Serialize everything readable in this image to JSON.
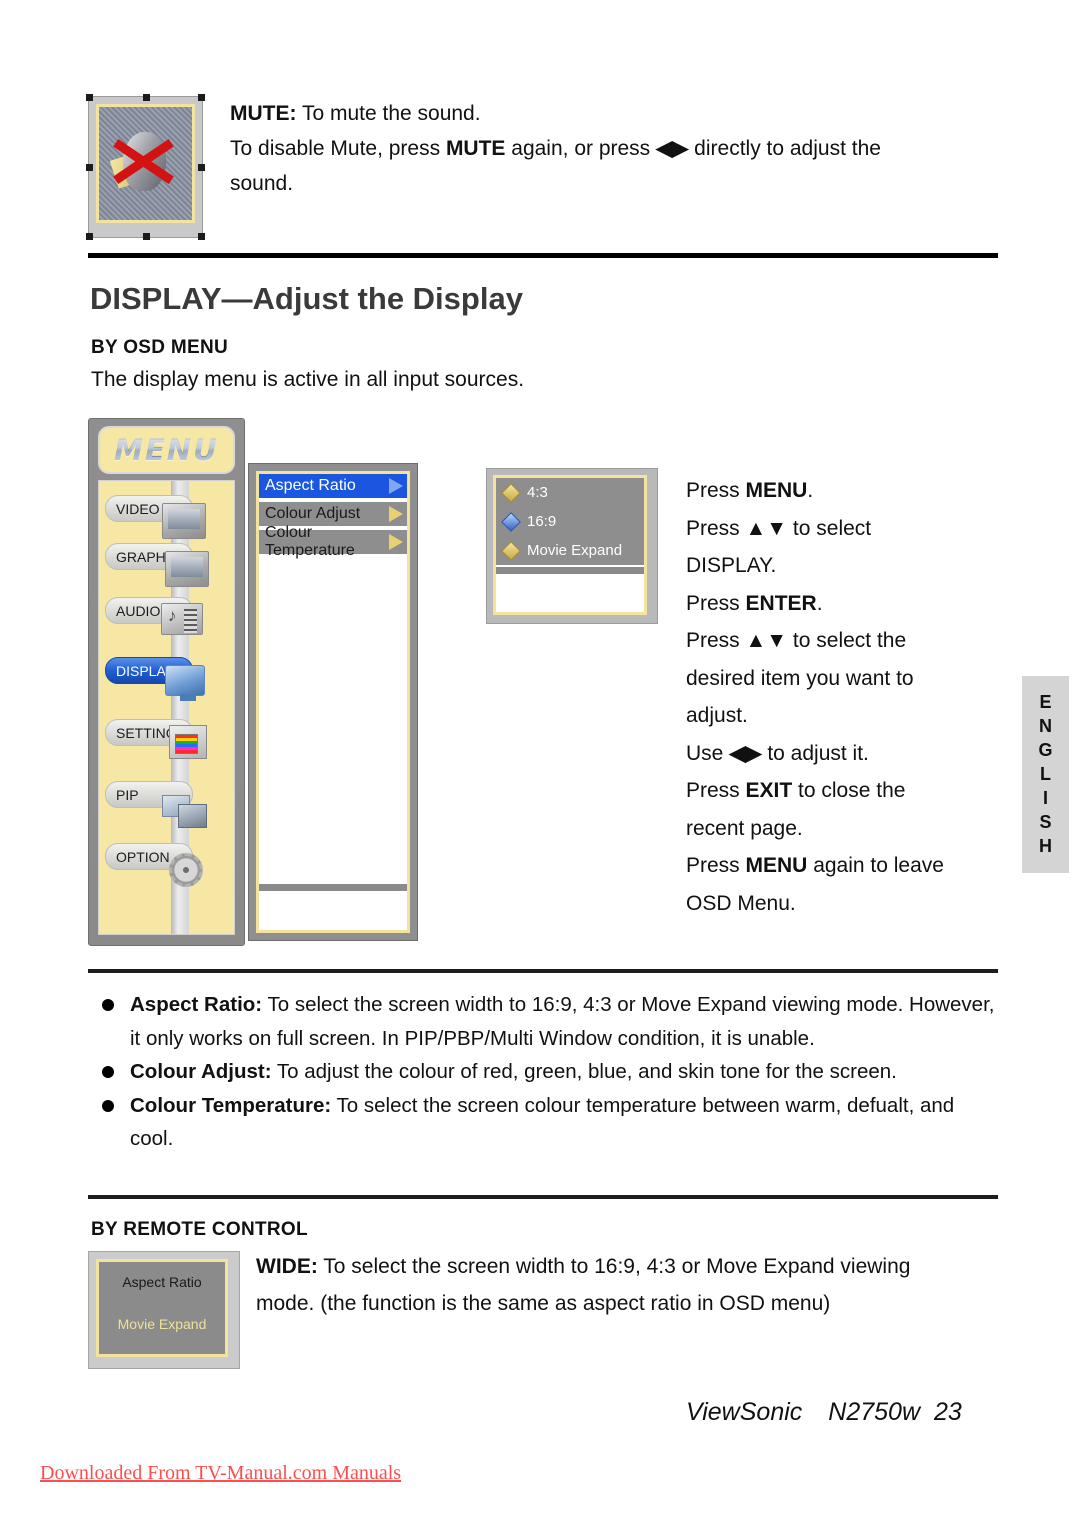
{
  "mute": {
    "thumb_name": "mute-speaker-crossed-out",
    "line1_bold": "MUTE:",
    "line1_rest": " To mute the sound.",
    "line2_a": "To disable Mute, press ",
    "line2_bold": "MUTE",
    "line2_b": " again, or press ",
    "line2_arrows": "◀▶",
    "line2_c": " directly to adjust the",
    "line3": "sound."
  },
  "section": {
    "title": "DISPLAY—Adjust the Display",
    "subhead": "BY OSD MENU",
    "intro": "The display menu is active in all input sources."
  },
  "osd": {
    "menu_label": "MENU",
    "items": [
      {
        "label": "VIDEO",
        "icon": "monitor-icon",
        "selected": false
      },
      {
        "label": "GRAPHICS",
        "icon": "rgb-monitor-icon",
        "selected": false
      },
      {
        "label": "AUDIO",
        "icon": "audio-icon",
        "selected": false
      },
      {
        "label": "DISPLAY",
        "icon": "display-monitor-icon",
        "selected": true
      },
      {
        "label": "SETTINGS",
        "icon": "settings-icon",
        "selected": false
      },
      {
        "label": "PIP",
        "icon": "pip-icon",
        "selected": false
      },
      {
        "label": "OPTION",
        "icon": "gear-icon",
        "selected": false
      }
    ],
    "submenu": [
      {
        "label": "Aspect Ratio",
        "selected": true
      },
      {
        "label": "Colour Adjust",
        "selected": false
      },
      {
        "label": "Colour Temperature",
        "selected": false
      }
    ],
    "values": [
      {
        "label": "4:3",
        "selected": false
      },
      {
        "label": "16:9",
        "selected": true
      },
      {
        "label": "Movie Expand",
        "selected": false
      }
    ],
    "colors": {
      "highlight_blue": "#1b56e0",
      "panel_gray": "#8e8e8e",
      "menu_yellow": "#f6e7a4",
      "frame_yellow": "#f3e39e"
    }
  },
  "instructions": {
    "lines": [
      {
        "pre": "Press ",
        "bold": "MENU",
        "post": "."
      },
      {
        "pre": "Press ",
        "bold": "▲▼",
        "post": " to select"
      },
      {
        "pre": "DISPLAY.",
        "bold": "",
        "post": ""
      },
      {
        "pre": "Press ",
        "bold": "ENTER",
        "post": "."
      },
      {
        "pre": "Press ",
        "bold": "▲▼",
        "post": " to select the"
      },
      {
        "pre": "desired item you want to",
        "bold": "",
        "post": ""
      },
      {
        "pre": "adjust.",
        "bold": "",
        "post": ""
      },
      {
        "pre": "Use ",
        "bold": "◀▶",
        "post": " to adjust it."
      },
      {
        "pre": "Press ",
        "bold": "EXIT",
        "post": " to close the"
      },
      {
        "pre": "recent page.",
        "bold": "",
        "post": ""
      },
      {
        "pre": "Press ",
        "bold": "MENU",
        "post": " again to leave"
      },
      {
        "pre": "OSD Menu.",
        "bold": "",
        "post": ""
      }
    ]
  },
  "english_tab": {
    "letters": [
      "E",
      "N",
      "G",
      "L",
      "I",
      "S",
      "H"
    ]
  },
  "bullets": [
    {
      "term": "Aspect Ratio:",
      "text": " To select the screen width to 16:9, 4:3 or Move Expand viewing mode. However, it only works on full screen. In PIP/PBP/Multi Window condition, it is unable."
    },
    {
      "term": "Colour Adjust:",
      "text": " To adjust the colour of red, green, blue, and skin tone for the screen."
    },
    {
      "term": "Colour Temperature:",
      "text": " To select the screen colour temperature between warm, defualt, and cool."
    }
  ],
  "remote": {
    "subhead": "BY REMOTE CONTROL",
    "thumb": {
      "top_label": "Aspect Ratio",
      "bottom_label": "Movie Expand"
    },
    "term": "WIDE:",
    "line1": " To select the screen width to 16:9, 4:3 or Move Expand viewing",
    "line2": "mode. (the function is the same as aspect ratio in OSD menu)"
  },
  "footer": {
    "brand": "ViewSonic",
    "model": "N2750w",
    "page": "23",
    "watermark": "Downloaded From TV-Manual.com Manuals",
    "watermark_color": "#ff4d4d"
  }
}
